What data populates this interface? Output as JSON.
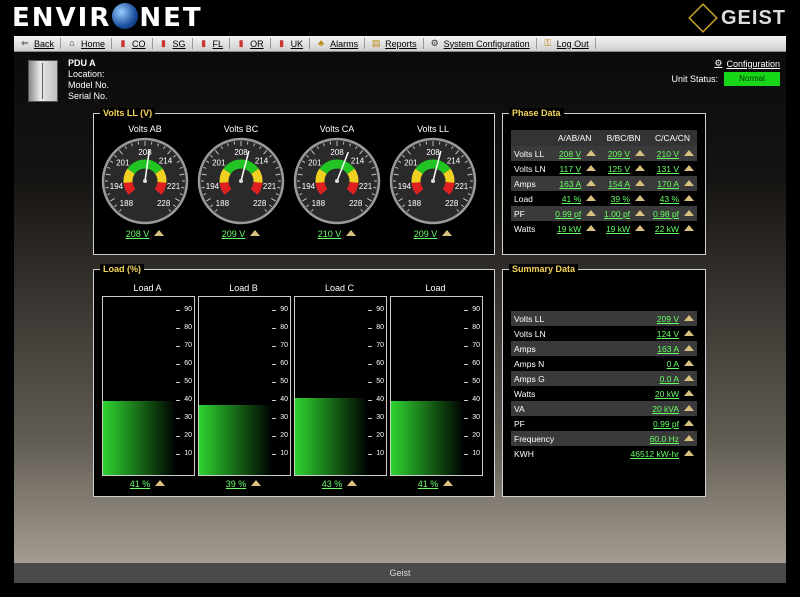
{
  "header": {
    "logo_left": "ENVIR",
    "logo_right": "NET",
    "brand": "GEIST"
  },
  "nav": [
    {
      "label": "Back",
      "icon": "back-arrow-icon",
      "glyph": "⇐",
      "color": "#333333"
    },
    {
      "label": "Home",
      "icon": "home-icon",
      "glyph": "⌂",
      "color": "#333333"
    },
    {
      "label": "CO",
      "icon": "bar-chart-icon",
      "glyph": "▮",
      "color": "#cc3333"
    },
    {
      "label": "SG",
      "icon": "bar-chart-icon",
      "glyph": "▮",
      "color": "#cc3333"
    },
    {
      "label": "FL",
      "icon": "bar-chart-icon",
      "glyph": "▮",
      "color": "#cc3333"
    },
    {
      "label": "OR",
      "icon": "bar-chart-icon",
      "glyph": "▮",
      "color": "#cc3333"
    },
    {
      "label": "UK",
      "icon": "bar-chart-icon",
      "glyph": "▮",
      "color": "#cc3333"
    },
    {
      "label": "Alarms",
      "icon": "bell-icon",
      "glyph": "♣",
      "color": "#b8860b"
    },
    {
      "label": "Reports",
      "icon": "reports-icon",
      "glyph": "▤",
      "color": "#b8860b"
    },
    {
      "label": "System Configuration",
      "icon": "gear-icon",
      "glyph": "⚙",
      "color": "#333333"
    },
    {
      "label": "Log Out",
      "icon": "key-icon",
      "glyph": "⚿",
      "color": "#b8860b"
    }
  ],
  "pdu": {
    "name": "PDU A",
    "location": "Location:",
    "model": "Model No.",
    "serial": "Serial No."
  },
  "config_label": "Configuration",
  "status": {
    "label": "Unit Status:",
    "value": "Normal"
  },
  "volts_panel": {
    "title": "Volts LL (V)",
    "tick_labels": [
      "188",
      "194",
      "201",
      "208",
      "214",
      "221",
      "228"
    ],
    "gauges": [
      {
        "title": "Volts AB",
        "value": "208 V",
        "reading": 208
      },
      {
        "title": "Volts BC",
        "value": "209 V",
        "reading": 209
      },
      {
        "title": "Volts CA",
        "value": "210 V",
        "reading": 210
      },
      {
        "title": "Volts LL",
        "value": "209 V",
        "reading": 209
      }
    ]
  },
  "phase_panel": {
    "title": "Phase Data",
    "headers": [
      "A/AB/AN",
      "B/BC/BN",
      "C/CA/CN"
    ],
    "rows": [
      {
        "label": "Volts LL",
        "values": [
          "208 V",
          "209 V",
          "210 V"
        ]
      },
      {
        "label": "Volts LN",
        "values": [
          "117 V",
          "125 V",
          "131 V"
        ]
      },
      {
        "label": "Amps",
        "values": [
          "163 A",
          "154 A",
          "170 A"
        ]
      },
      {
        "label": "Load",
        "values": [
          "41 %",
          "39 %",
          "43 %"
        ]
      },
      {
        "label": "PF",
        "values": [
          "0.99 pf",
          "1.00 pf",
          "0.98 pf"
        ]
      },
      {
        "label": "Watts",
        "values": [
          "19 kW",
          "19 kW",
          "22 kW"
        ]
      }
    ]
  },
  "load_panel": {
    "title": "Load (%)",
    "ticks": [
      "90",
      "80",
      "70",
      "60",
      "50",
      "40",
      "30",
      "20",
      "10"
    ],
    "bars": [
      {
        "title": "Load A",
        "value": "41 %",
        "percent": 41
      },
      {
        "title": "Load B",
        "value": "39 %",
        "percent": 39
      },
      {
        "title": "Load C",
        "value": "43 %",
        "percent": 43
      },
      {
        "title": "Load",
        "value": "41 %",
        "percent": 41
      }
    ]
  },
  "summary_panel": {
    "title": "Summary Data",
    "rows": [
      {
        "label": "Volts LL",
        "value": "209 V"
      },
      {
        "label": "Volts LN",
        "value": "124 V"
      },
      {
        "label": "Amps",
        "value": "163 A"
      },
      {
        "label": "Amps N",
        "value": "0 A"
      },
      {
        "label": "Amps G",
        "value": "0.0 A"
      },
      {
        "label": "Watts",
        "value": "20 kW"
      },
      {
        "label": "VA",
        "value": "20 kVA"
      },
      {
        "label": "PF",
        "value": "0.99 pf"
      },
      {
        "label": "Frequency",
        "value": "60.0 Hz"
      },
      {
        "label": "KWH",
        "value": "46512 kW-hr"
      }
    ]
  },
  "footer": "Geist"
}
